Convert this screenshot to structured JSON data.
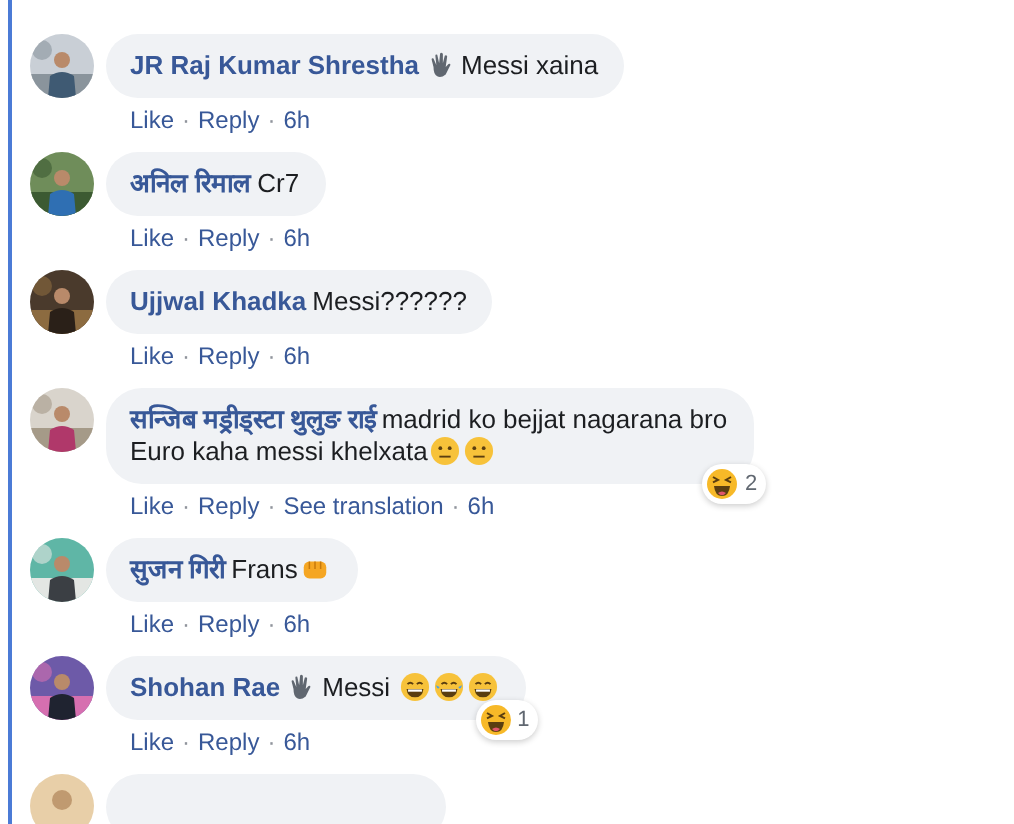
{
  "separator": "·",
  "comments": [
    {
      "kind": "comment",
      "name": "JR Raj Kumar Shrestha",
      "parts": [
        {
          "kind": "wave-emoji"
        },
        {
          "kind": "text",
          "text": "Messi xaina"
        }
      ],
      "actions": [
        "Like",
        "Reply",
        "6h"
      ]
    },
    {
      "kind": "comment",
      "name": "अनिल रिमाल",
      "parts": [
        {
          "kind": "text",
          "text": "Cr7"
        }
      ],
      "actions": [
        "Like",
        "Reply",
        "6h"
      ]
    },
    {
      "kind": "comment",
      "name": "Ujjwal Khadka",
      "parts": [
        {
          "kind": "text",
          "text": "Messi??????"
        }
      ],
      "actions": [
        "Like",
        "Reply",
        "6h"
      ]
    },
    {
      "kind": "comment",
      "name": "सन्जिब मड्रीड्स्टा थुलुङ राई",
      "parts": [
        {
          "kind": "text",
          "text": "madrid ko bejjat nagarana bro"
        },
        {
          "kind": "break"
        },
        {
          "kind": "text",
          "text": "Euro kaha messi khelxata"
        },
        {
          "kind": "neutral-emoji"
        },
        {
          "kind": "neutral-emoji"
        }
      ],
      "actions": [
        "Like",
        "Reply",
        "See translation",
        "6h"
      ],
      "reaction": {
        "count": "2"
      }
    },
    {
      "kind": "comment",
      "name": "सुजन गिरी",
      "parts": [
        {
          "kind": "text",
          "text": "Frans"
        },
        {
          "kind": "fist-emoji"
        }
      ],
      "actions": [
        "Like",
        "Reply",
        "6h"
      ]
    },
    {
      "kind": "comment",
      "name": "Shohan Rae",
      "parts": [
        {
          "kind": "wave-emoji"
        },
        {
          "kind": "text",
          "text": "Messi "
        },
        {
          "kind": "grin-emoji"
        },
        {
          "kind": "joy-emoji"
        },
        {
          "kind": "grin-emoji"
        }
      ],
      "actions": [
        "Like",
        "Reply",
        "6h"
      ],
      "reaction": {
        "count": "1"
      }
    },
    {
      "kind": "cut"
    }
  ]
}
